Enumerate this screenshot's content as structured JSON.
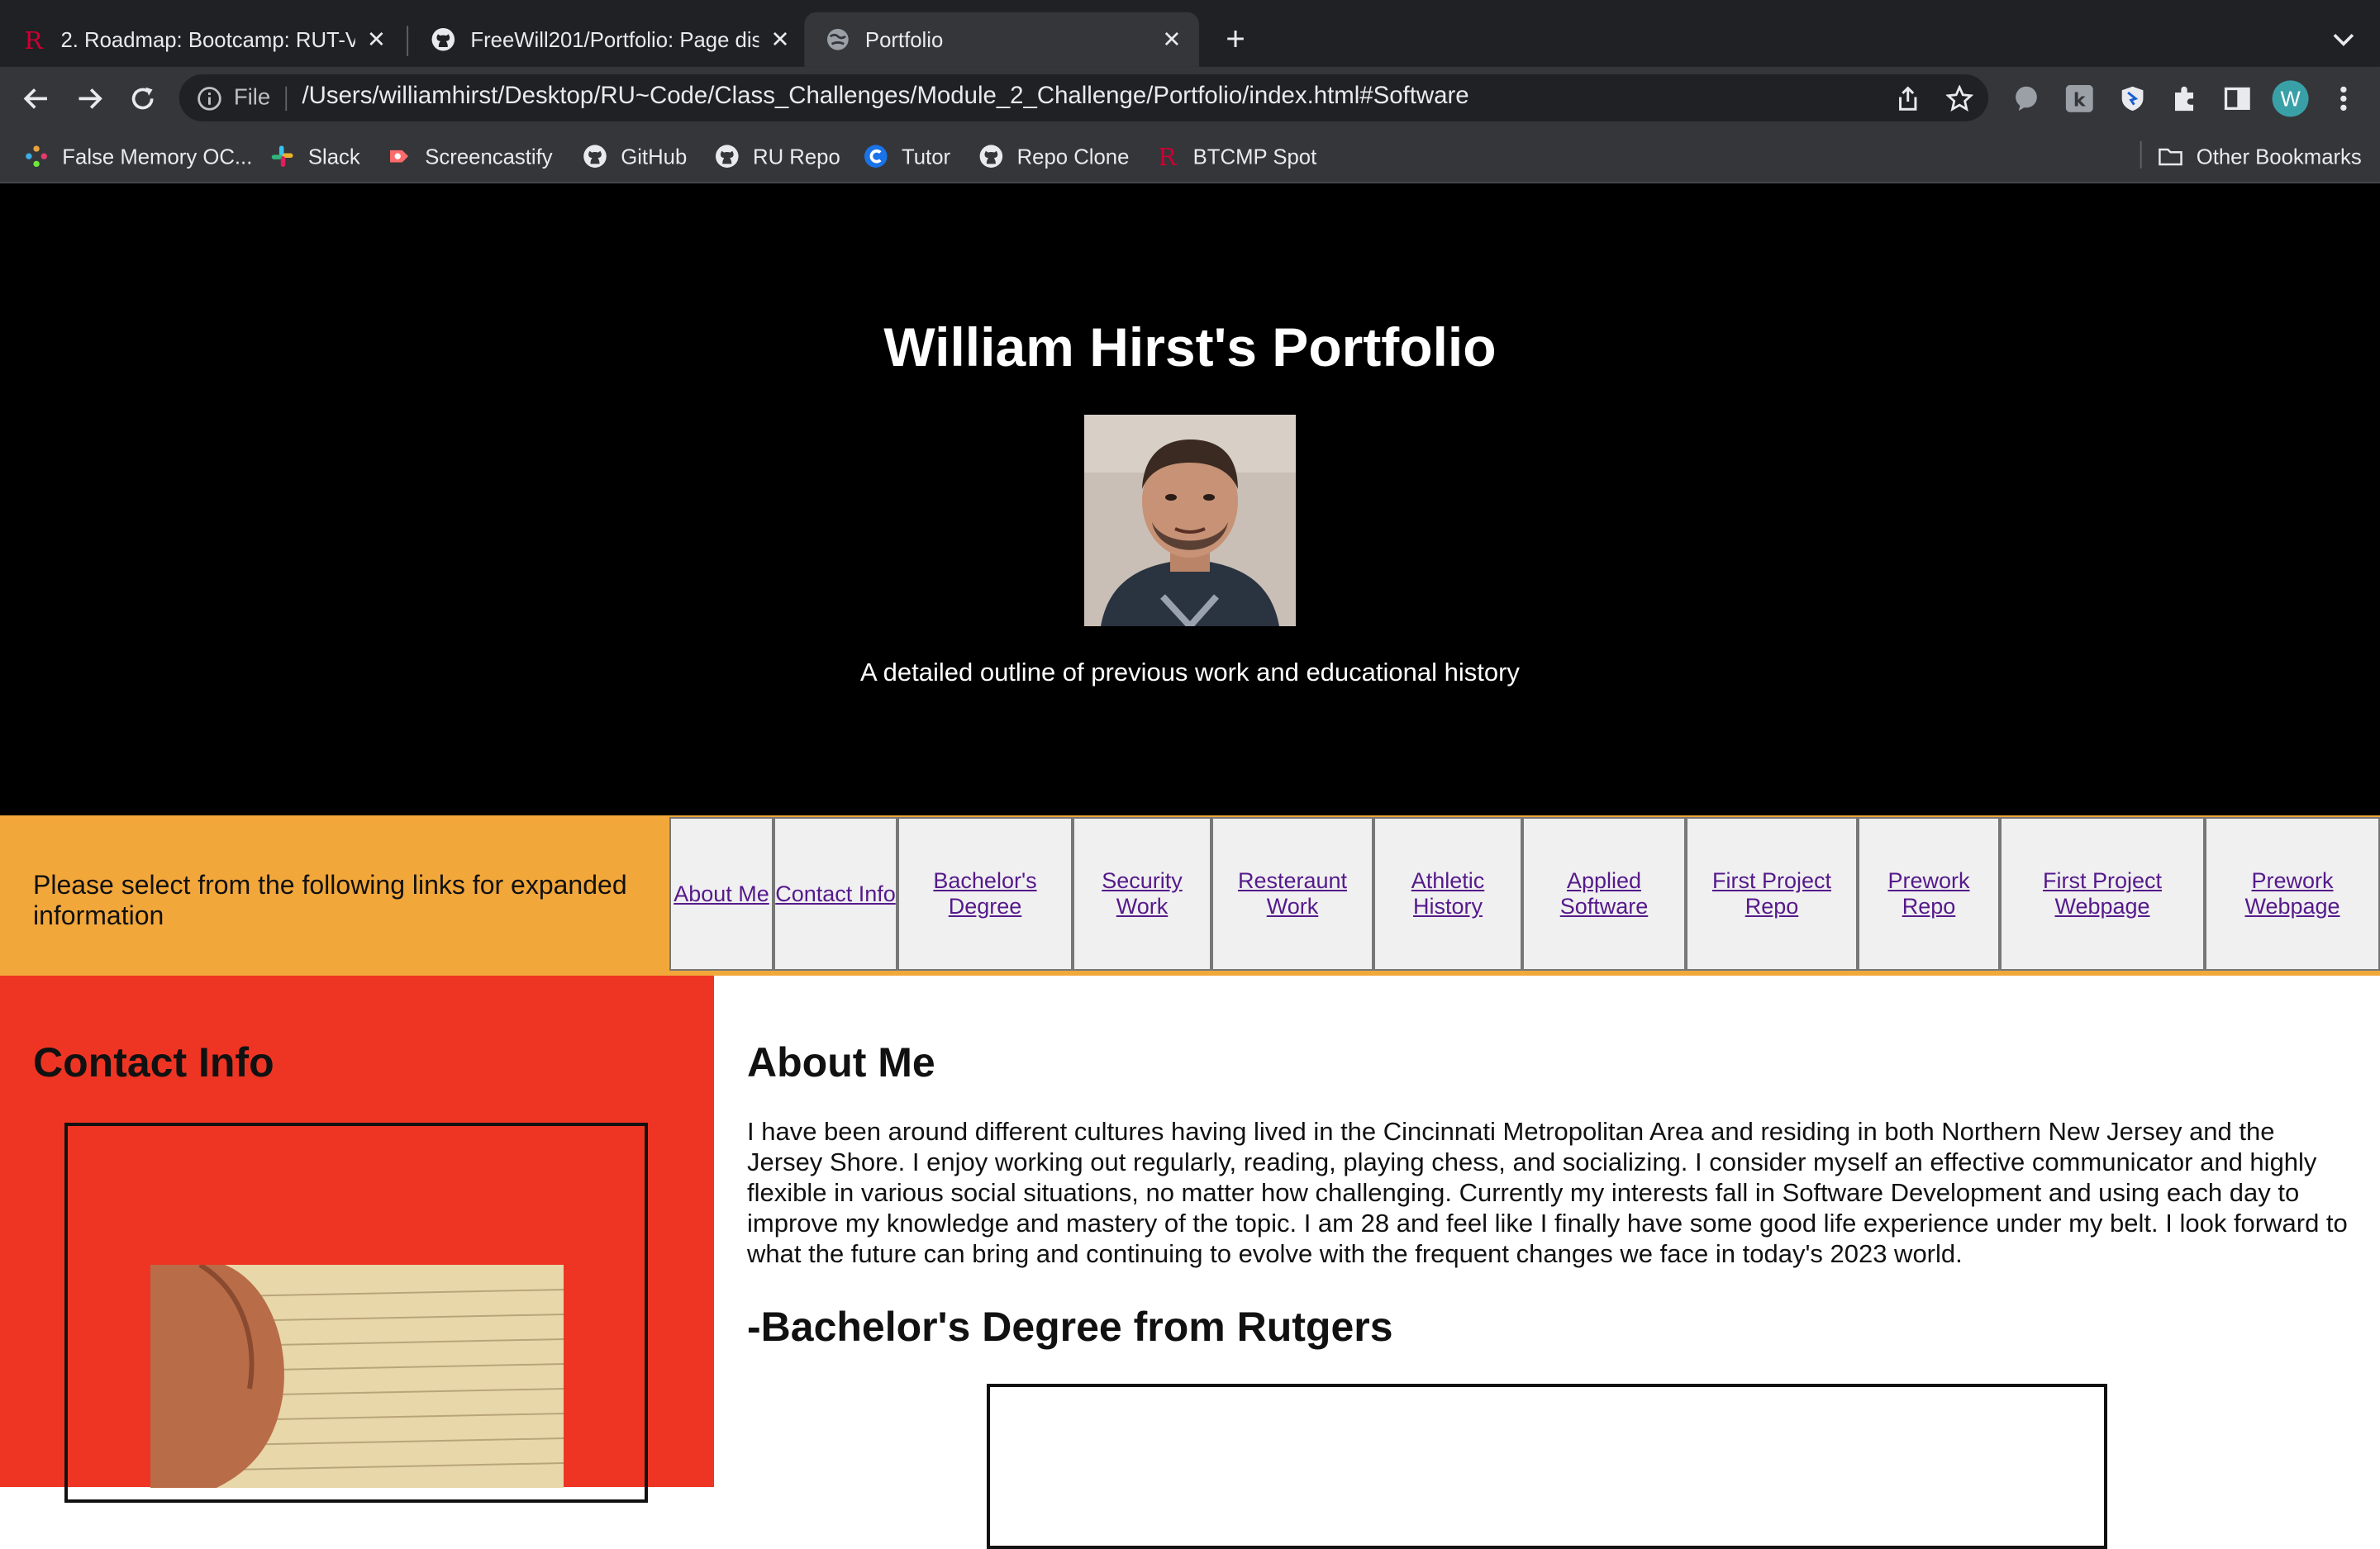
{
  "browser": {
    "tabs": [
      {
        "title": "2. Roadmap: Bootcamp: RUT-V",
        "favicon": "rutgers-r-icon",
        "active": false
      },
      {
        "title": "FreeWill201/Portfolio: Page disp",
        "favicon": "github-icon",
        "active": false
      },
      {
        "title": "Portfolio",
        "favicon": "globe-icon",
        "active": true
      }
    ],
    "address_bar": {
      "scheme_label": "File",
      "url": "/Users/williamhirst/Desktop/RU~Code/Class_Challenges/Module_2_Challenge/Portfolio/index.html#Software"
    },
    "profile_initial": "W",
    "bookmarks": [
      {
        "label": "False Memory OC...",
        "icon": "colorful-dots-icon"
      },
      {
        "label": "Slack",
        "icon": "slack-icon"
      },
      {
        "label": "Screencastify",
        "icon": "screencastify-icon"
      },
      {
        "label": "GitHub",
        "icon": "github-icon"
      },
      {
        "label": "RU Repo",
        "icon": "github-icon"
      },
      {
        "label": "Tutor",
        "icon": "tutor-icon"
      },
      {
        "label": "Repo Clone",
        "icon": "github-icon"
      },
      {
        "label": "BTCMP Spot",
        "icon": "rutgers-r-icon"
      }
    ],
    "other_bookmarks": "Other Bookmarks"
  },
  "hero": {
    "title": "William Hirst's Portfolio",
    "subtitle": "A detailed outline of previous work and educational history"
  },
  "nav": {
    "prompt": "Please select from the following links for expanded information",
    "links": [
      {
        "label": "About Me"
      },
      {
        "label": "Contact Info"
      },
      {
        "label": "Bachelor's Degree"
      },
      {
        "label": "Security Work"
      },
      {
        "label": "Resteraunt Work"
      },
      {
        "label": "Athletic History"
      },
      {
        "label": "Applied Software"
      },
      {
        "label": "First Project Repo"
      },
      {
        "label": "Prework Repo"
      },
      {
        "label": "First Project Webpage"
      },
      {
        "label": "Prework Webpage"
      }
    ]
  },
  "sidebar": {
    "heading": "Contact Info"
  },
  "main": {
    "about_heading": "About Me",
    "about_text": "I have been around different cultures having lived in the Cincinnati Metropolitan Area and residing in both Northern New Jersey and the Jersey Shore. I enjoy working out regularly, reading, playing chess, and socializing. I consider myself an effective communicator and highly flexible in various social situations, no matter how challenging. Currently my interests fall in Software Development and using each day to improve my knowledge and mastery of the topic. I am 28 and feel like I finally have some good life experience under my belt. I look forward to what the future can bring and continuing to evolve with the frequent changes we face in today's 2023 world.",
    "degree_heading": "-Bachelor's Degree from Rutgers"
  },
  "colors": {
    "hero_bg": "#000000",
    "nav_bg": "#f2a73b",
    "sidebar_bg": "#ee3524",
    "link": "#551a8b",
    "chrome_bg": "#202124",
    "toolbar_bg": "#35363a"
  }
}
